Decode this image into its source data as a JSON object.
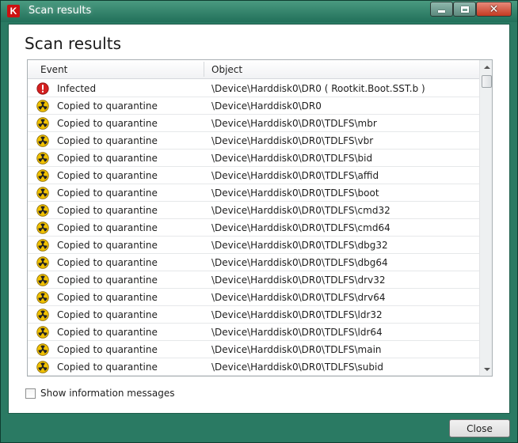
{
  "window": {
    "title": "Scan results",
    "app_icon_text": "K"
  },
  "panel": {
    "title": "Scan results"
  },
  "table": {
    "columns": {
      "event": "Event",
      "object": "Object"
    },
    "rows": [
      {
        "icon": "infected-icon",
        "event": "Infected",
        "object": "\\Device\\Harddisk0\\DR0 ( Rootkit.Boot.SST.b )"
      },
      {
        "icon": "quarantine-icon",
        "event": "Copied to quarantine",
        "object": "\\Device\\Harddisk0\\DR0"
      },
      {
        "icon": "quarantine-icon",
        "event": "Copied to quarantine",
        "object": "\\Device\\Harddisk0\\DR0\\TDLFS\\mbr"
      },
      {
        "icon": "quarantine-icon",
        "event": "Copied to quarantine",
        "object": "\\Device\\Harddisk0\\DR0\\TDLFS\\vbr"
      },
      {
        "icon": "quarantine-icon",
        "event": "Copied to quarantine",
        "object": "\\Device\\Harddisk0\\DR0\\TDLFS\\bid"
      },
      {
        "icon": "quarantine-icon",
        "event": "Copied to quarantine",
        "object": "\\Device\\Harddisk0\\DR0\\TDLFS\\affid"
      },
      {
        "icon": "quarantine-icon",
        "event": "Copied to quarantine",
        "object": "\\Device\\Harddisk0\\DR0\\TDLFS\\boot"
      },
      {
        "icon": "quarantine-icon",
        "event": "Copied to quarantine",
        "object": "\\Device\\Harddisk0\\DR0\\TDLFS\\cmd32"
      },
      {
        "icon": "quarantine-icon",
        "event": "Copied to quarantine",
        "object": "\\Device\\Harddisk0\\DR0\\TDLFS\\cmd64"
      },
      {
        "icon": "quarantine-icon",
        "event": "Copied to quarantine",
        "object": "\\Device\\Harddisk0\\DR0\\TDLFS\\dbg32"
      },
      {
        "icon": "quarantine-icon",
        "event": "Copied to quarantine",
        "object": "\\Device\\Harddisk0\\DR0\\TDLFS\\dbg64"
      },
      {
        "icon": "quarantine-icon",
        "event": "Copied to quarantine",
        "object": "\\Device\\Harddisk0\\DR0\\TDLFS\\drv32"
      },
      {
        "icon": "quarantine-icon",
        "event": "Copied to quarantine",
        "object": "\\Device\\Harddisk0\\DR0\\TDLFS\\drv64"
      },
      {
        "icon": "quarantine-icon",
        "event": "Copied to quarantine",
        "object": "\\Device\\Harddisk0\\DR0\\TDLFS\\ldr32"
      },
      {
        "icon": "quarantine-icon",
        "event": "Copied to quarantine",
        "object": "\\Device\\Harddisk0\\DR0\\TDLFS\\ldr64"
      },
      {
        "icon": "quarantine-icon",
        "event": "Copied to quarantine",
        "object": "\\Device\\Harddisk0\\DR0\\TDLFS\\main"
      },
      {
        "icon": "quarantine-icon",
        "event": "Copied to quarantine",
        "object": "\\Device\\Harddisk0\\DR0\\TDLFS\\subid"
      }
    ]
  },
  "options": {
    "show_info_label": "Show information messages",
    "show_info_checked": false
  },
  "footer": {
    "close_label": "Close"
  },
  "colors": {
    "window_frame": "#2a7a63",
    "infected": "#d42020",
    "quarantine_fill": "#f2c200",
    "quarantine_mark": "#222222"
  }
}
